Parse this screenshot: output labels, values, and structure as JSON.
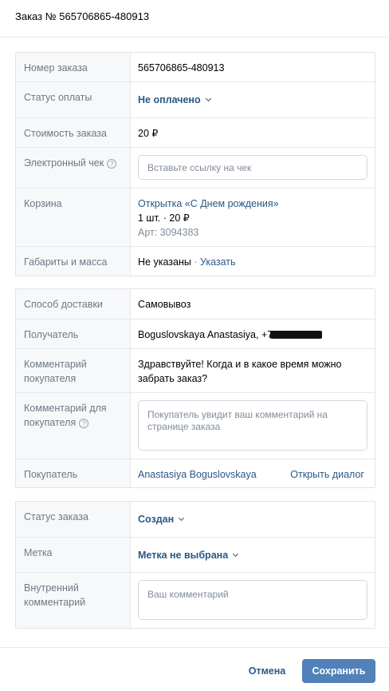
{
  "header": {
    "title": "Заказ № 565706865-480913"
  },
  "order": {
    "number_label": "Номер заказа",
    "number_value": "565706865-480913",
    "payment_label": "Статус оплаты",
    "payment_value": "Не оплачено",
    "cost_label": "Стоимость заказа",
    "cost_value": "20 ₽",
    "receipt_label": "Электронный чек",
    "receipt_placeholder": "Вставьте ссылку на чек",
    "cart_label": "Корзина",
    "cart_item_name": "Открытка «С Днем рождения»",
    "cart_item_qty": "1 шт.",
    "cart_item_sep": "·",
    "cart_item_price": "20 ₽",
    "cart_item_sku": "Арт: 3094383",
    "dims_label": "Габариты и масса",
    "dims_value": "Не указаны",
    "dims_sep": "·",
    "dims_link": "Указать"
  },
  "delivery": {
    "method_label": "Способ доставки",
    "method_value": "Самовывоз",
    "recipient_label": "Получатель",
    "recipient_value": "Boguslovskaya Anastasiya, +7",
    "buyer_comment_label": "Комментарий покупателя",
    "buyer_comment_value": "Здравствуйте! Когда и в какое время можно забрать заказ?",
    "comment_for_buyer_label": "Комментарий для покупателя",
    "comment_for_buyer_placeholder": "Покупатель увидит ваш комментарий на странице заказа",
    "buyer_label": "Покупатель",
    "buyer_name": "Anastasiya Boguslovskaya",
    "open_dialog": "Открыть диалог"
  },
  "status": {
    "order_status_label": "Статус заказа",
    "order_status_value": "Создан",
    "tag_label": "Метка",
    "tag_value": "Метка не выбрана",
    "internal_comment_label": "Внутренний комментарий",
    "internal_comment_placeholder": "Ваш комментарий"
  },
  "footer": {
    "cancel": "Отмена",
    "save": "Сохранить"
  },
  "colors": {
    "link": "#2a5885",
    "primary_button": "#5181b8",
    "label_bg": "#f7f8fa"
  }
}
